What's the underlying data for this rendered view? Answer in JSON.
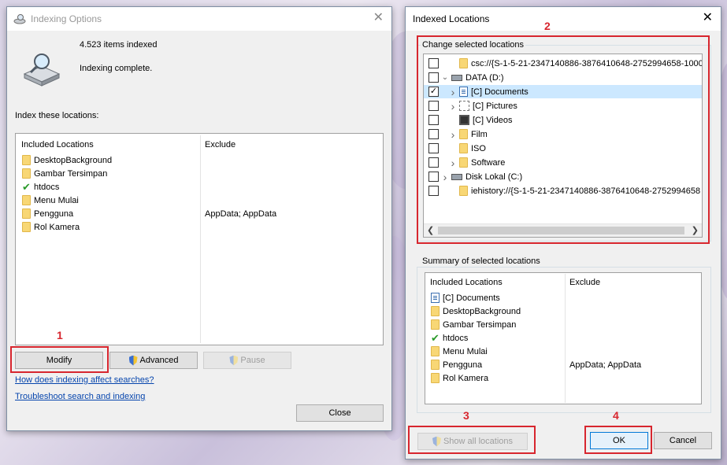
{
  "indexing_options": {
    "title": "Indexing Options",
    "items_indexed": "4.523 items indexed",
    "status": "Indexing complete.",
    "section_label": "Index these locations:",
    "col_included": "Included Locations",
    "col_exclude": "Exclude",
    "rows": [
      {
        "name": "DesktopBackground",
        "icon": "folder-icon",
        "exclude": ""
      },
      {
        "name": "Gambar Tersimpan",
        "icon": "folder-icon",
        "exclude": ""
      },
      {
        "name": "htdocs",
        "icon": "checkmark-icon",
        "exclude": ""
      },
      {
        "name": "Menu Mulai",
        "icon": "folder-icon",
        "exclude": ""
      },
      {
        "name": "Pengguna",
        "icon": "folder-icon",
        "exclude": "AppData; AppData"
      },
      {
        "name": "Rol Kamera",
        "icon": "folder-icon",
        "exclude": ""
      }
    ],
    "modify_label": "Modify",
    "advanced_label": "Advanced",
    "pause_label": "Pause",
    "link_affect": "How does indexing affect searches?",
    "link_troubleshoot": "Troubleshoot search and indexing",
    "close_label": "Close"
  },
  "indexed_locations": {
    "title": "Indexed Locations",
    "change_label": "Change selected locations",
    "tree": [
      {
        "label": "csc://{S-1-5-21-2347140886-3876410648-2752994658-1000",
        "checked": false,
        "expander": "",
        "icon": "folder-icon",
        "level": 1
      },
      {
        "label": "DATA (D:)",
        "checked": false,
        "expander": "v",
        "icon": "drive-icon",
        "level": 0
      },
      {
        "label": "[C] Documents",
        "checked": true,
        "expander": ">",
        "icon": "document-icon",
        "level": 1,
        "selected": true
      },
      {
        "label": "[C] Pictures",
        "checked": false,
        "expander": ">",
        "icon": "pictures-icon",
        "level": 1
      },
      {
        "label": "[C] Videos",
        "checked": false,
        "expander": "",
        "icon": "video-icon",
        "level": 1
      },
      {
        "label": "Film",
        "checked": false,
        "expander": ">",
        "icon": "folder-icon",
        "level": 1
      },
      {
        "label": "ISO",
        "checked": false,
        "expander": "",
        "icon": "folder-icon",
        "level": 1
      },
      {
        "label": "Software",
        "checked": false,
        "expander": ">",
        "icon": "folder-icon",
        "level": 1
      },
      {
        "label": "Disk Lokal (C:)",
        "checked": false,
        "expander": ">",
        "icon": "drive-icon",
        "level": 0
      },
      {
        "label": "iehistory://{S-1-5-21-2347140886-3876410648-2752994658",
        "checked": false,
        "expander": "",
        "icon": "folder-icon",
        "level": 1
      }
    ],
    "summary_label": "Summary of selected locations",
    "col_included": "Included Locations",
    "col_exclude": "Exclude",
    "summary_rows": [
      {
        "name": "[C] Documents",
        "icon": "document-icon",
        "exclude": ""
      },
      {
        "name": "DesktopBackground",
        "icon": "folder-icon",
        "exclude": ""
      },
      {
        "name": "Gambar Tersimpan",
        "icon": "folder-icon",
        "exclude": ""
      },
      {
        "name": "htdocs",
        "icon": "checkmark-icon",
        "exclude": ""
      },
      {
        "name": "Menu Mulai",
        "icon": "folder-icon",
        "exclude": ""
      },
      {
        "name": "Pengguna",
        "icon": "folder-icon",
        "exclude": "AppData; AppData"
      },
      {
        "name": "Rol Kamera",
        "icon": "folder-icon",
        "exclude": ""
      }
    ],
    "show_all_label": "Show all locations",
    "ok_label": "OK",
    "cancel_label": "Cancel"
  },
  "annotations": [
    "1",
    "2",
    "3",
    "4"
  ],
  "colors": {
    "annotation_red": "#d7262e",
    "link_blue": "#0645ad",
    "selection_blue": "#cce8ff"
  }
}
